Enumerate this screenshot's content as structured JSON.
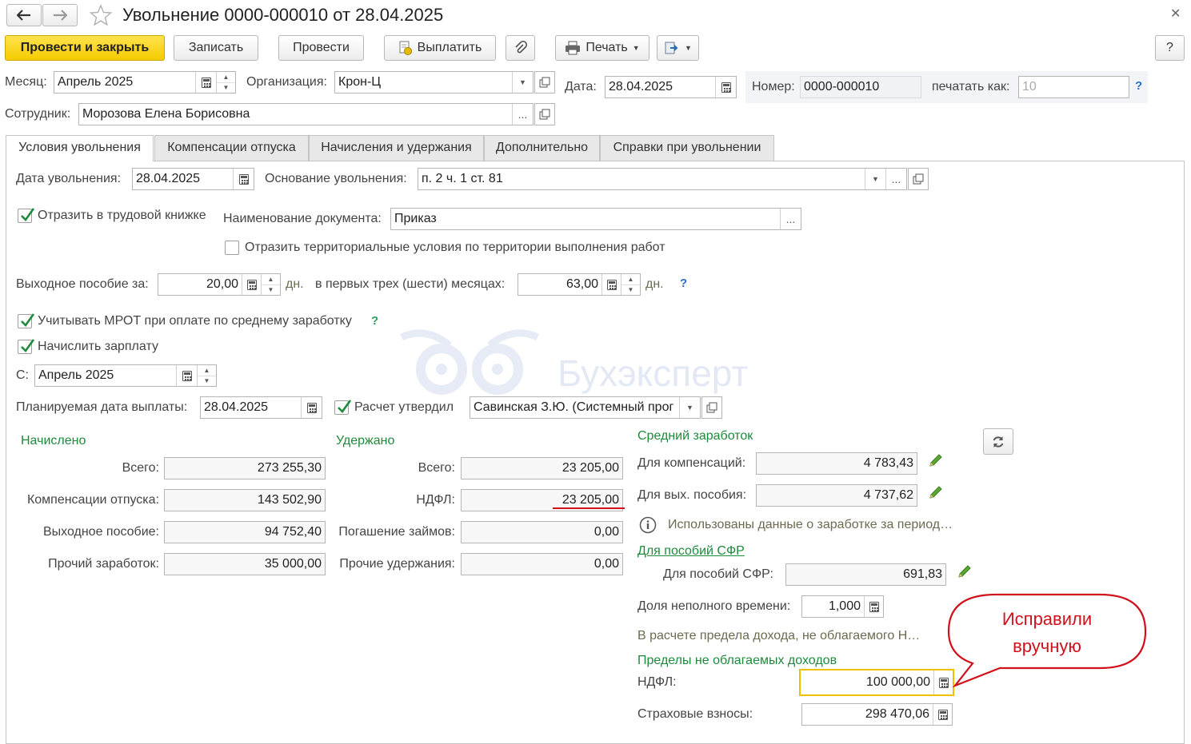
{
  "title": "Увольнение 0000-000010 от 28.04.2025",
  "toolbar": {
    "post_close": "Провести и закрыть",
    "save": "Записать",
    "post": "Провести",
    "pay": "Выплатить",
    "print": "Печать",
    "help": "?"
  },
  "header": {
    "month_label": "Месяц:",
    "month_value": "Апрель 2025",
    "org_label": "Организация:",
    "org_value": "Крон-Ц",
    "date_label": "Дата:",
    "date_value": "28.04.2025",
    "number_label": "Номер:",
    "number_value": "0000-000010",
    "print_as_label": "печатать как:",
    "print_as_value": "10",
    "employee_label": "Сотрудник:",
    "employee_value": "Морозова Елена Борисовна",
    "q": "?"
  },
  "tabs": [
    {
      "label": "Условия увольнения",
      "active": true
    },
    {
      "label": "Компенсации отпуска",
      "active": false
    },
    {
      "label": "Начисления и удержания",
      "active": false
    },
    {
      "label": "Дополнительно",
      "active": false
    },
    {
      "label": "Справки при увольнении",
      "active": false
    }
  ],
  "form": {
    "dismissal_date_label": "Дата увольнения:",
    "dismissal_date_value": "28.04.2025",
    "reason_label": "Основание увольнения:",
    "reason_value": "п. 2 ч. 1 ст. 81",
    "workbook_label": "Отразить в трудовой книжке",
    "workbook_checked": true,
    "doc_name_label": "Наименование документа:",
    "doc_name_value": "Приказ",
    "territorial_label": "Отразить территориальные условия по территории выполнения работ",
    "territorial_checked": false,
    "severance_label": "Выходное пособие за:",
    "severance_value": "20,00",
    "days": "дн.",
    "first_months_label": "в первых трех (шести) месяцах:",
    "first_months_value": "63,00",
    "mrot_label": "Учитывать МРОТ при оплате по среднему заработку",
    "mrot_checked": true,
    "accrue_salary_label": "Начислить зарплату",
    "accrue_salary_checked": true,
    "from_label": "С:",
    "from_value": "Апрель 2025",
    "planned_date_label": "Планируемая дата выплаты:",
    "planned_date_value": "28.04.2025",
    "approved_label": "Расчет утвердил",
    "approved_checked": true,
    "approved_value": "Савинская З.Ю. (Системный прог"
  },
  "accrued": {
    "header": "Начислено",
    "rows": [
      {
        "label": "Всего:",
        "value": "273 255,30"
      },
      {
        "label": "Компенсации отпуска:",
        "value": "143 502,90"
      },
      {
        "label": "Выходное пособие:",
        "value": "94 752,40"
      },
      {
        "label": "Прочий заработок:",
        "value": "35 000,00"
      }
    ]
  },
  "withheld": {
    "header": "Удержано",
    "rows": [
      {
        "label": "Всего:",
        "value": "23 205,00"
      },
      {
        "label": "НДФЛ:",
        "value": "23 205,00"
      },
      {
        "label": "Погашение займов:",
        "value": "0,00"
      },
      {
        "label": "Прочие удержания:",
        "value": "0,00"
      }
    ]
  },
  "avg": {
    "header": "Средний заработок",
    "comp_label": "Для компенсаций:",
    "comp_value": "4 783,43",
    "sev_label": "Для вых. пособия:",
    "sev_value": "4 737,62",
    "info_text": "Использованы данные о заработке за период…",
    "sfr_link": "Для пособий СФР",
    "sfr_label": "Для пособий СФР:",
    "sfr_value": "691,83",
    "part_time_label": "Доля неполного времени:",
    "part_time_value": "1,000",
    "note_text": "В расчете предела дохода, не облагаемого Н…",
    "limits_header": "Пределы не облагаемых доходов",
    "ndfl_label": "НДФЛ:",
    "ndfl_value": "100 000,00",
    "ins_label": "Страховые взносы:",
    "ins_value": "298 470,06"
  },
  "callout": {
    "line1": "Исправили",
    "line2": "вручную",
    "color": "#d0101a"
  },
  "watermark": "Бухэксперт"
}
